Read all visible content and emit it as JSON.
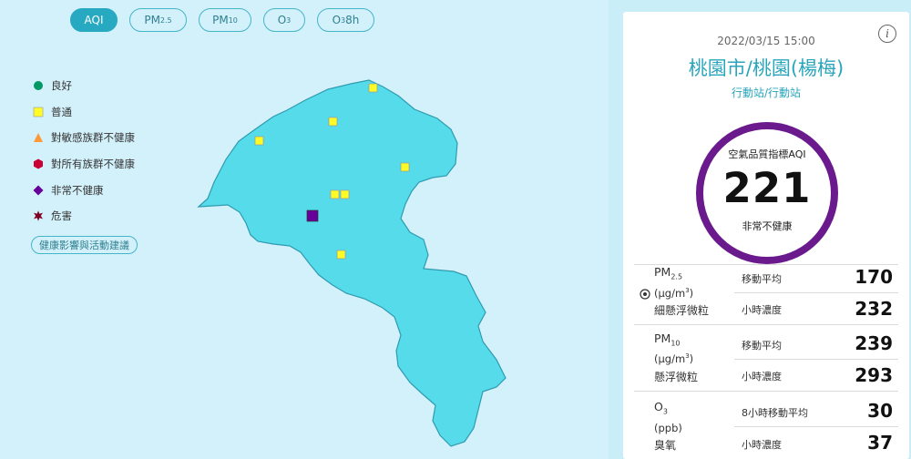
{
  "tabs": [
    {
      "label": "AQI",
      "sub": "",
      "tail": "",
      "active": true
    },
    {
      "label": "PM",
      "sub": "2.5",
      "tail": "",
      "active": false
    },
    {
      "label": "PM",
      "sub": "10",
      "tail": "",
      "active": false
    },
    {
      "label": "O",
      "sub": "3",
      "tail": "",
      "active": false
    },
    {
      "label": "O",
      "sub": "3",
      "tail": " 8h",
      "active": false
    }
  ],
  "legend": [
    {
      "label": "良好",
      "shape": "circle",
      "color": "#009865"
    },
    {
      "label": "普通",
      "shape": "square",
      "color": "#fffb26"
    },
    {
      "label": "對敏感族群不健康",
      "shape": "triangle",
      "color": "#ff9835"
    },
    {
      "label": "對所有族群不健康",
      "shape": "hexagon",
      "color": "#ca0034"
    },
    {
      "label": "非常不健康",
      "shape": "diamond",
      "color": "#670099"
    },
    {
      "label": "危害",
      "shape": "star",
      "color": "#7e0123"
    }
  ],
  "advice_button": "健康影響與活動建議",
  "map": {
    "region_color": "#55dbea",
    "station_colors": {
      "moderate": "#fffb26",
      "very_unhealthy": "#670099"
    }
  },
  "panel": {
    "datetime": "2022/03/15 15:00",
    "station_name": "桃園市/桃園(楊梅)",
    "station_type": "行動站/行動站",
    "info_icon": "i",
    "aqi": {
      "label": "空氣品質指標AQI",
      "value": "221",
      "status": "非常不健康",
      "ring_color": "#6a1a8c"
    },
    "pollutants": [
      {
        "name": "PM",
        "sub": "2.5",
        "unit": "(μg/m",
        "unit_sup": "3",
        "unit_tail": ")",
        "cn": "細懸浮微粒",
        "rows": [
          {
            "label": "移動平均",
            "value": "170"
          },
          {
            "label": "小時濃度",
            "value": "232"
          }
        ]
      },
      {
        "name": "PM",
        "sub": "10",
        "unit": "(μg/m",
        "unit_sup": "3",
        "unit_tail": ")",
        "cn": "懸浮微粒",
        "rows": [
          {
            "label": "移動平均",
            "value": "239"
          },
          {
            "label": "小時濃度",
            "value": "293"
          }
        ]
      },
      {
        "name": "O",
        "sub": "3",
        "unit": "(ppb)",
        "unit_sup": "",
        "unit_tail": "",
        "cn": "臭氧",
        "rows": [
          {
            "label": "8小時移動平均",
            "value": "30"
          },
          {
            "label": "小時濃度",
            "value": "37"
          }
        ]
      }
    ]
  }
}
